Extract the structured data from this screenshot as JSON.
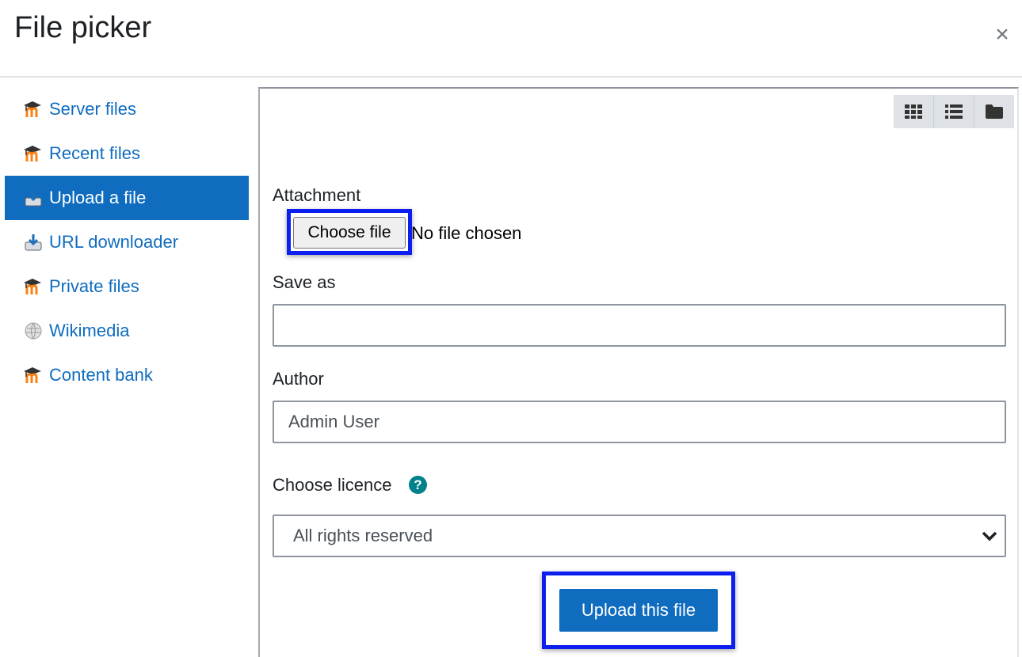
{
  "dialog": {
    "title": "File picker",
    "close_symbol": "×"
  },
  "sidebar": {
    "items": [
      {
        "label": "Server files",
        "icon": "moodle-icon",
        "active": false
      },
      {
        "label": "Recent files",
        "icon": "moodle-icon",
        "active": false
      },
      {
        "label": "Upload a file",
        "icon": "upload-repository-icon",
        "active": true
      },
      {
        "label": "URL downloader",
        "icon": "url-downloader-icon",
        "active": false
      },
      {
        "label": "Private files",
        "icon": "moodle-icon",
        "active": false
      },
      {
        "label": "Wikimedia",
        "icon": "wikimedia-globe-icon",
        "active": false
      },
      {
        "label": "Content bank",
        "icon": "moodle-icon",
        "active": false
      }
    ]
  },
  "toolbar": {
    "views": [
      "grid-view-icon",
      "list-view-icon",
      "tree-view-icon"
    ]
  },
  "form": {
    "attachment_label": "Attachment",
    "choose_file_label": "Choose file",
    "no_file_text": "No file chosen",
    "save_as_label": "Save as",
    "save_as_value": "",
    "author_label": "Author",
    "author_value": "Admin User",
    "licence_label": "Choose licence",
    "help_symbol": "?",
    "licence_value": "All rights reserved",
    "upload_button": "Upload this file"
  },
  "colors": {
    "accent": "#0f6cbf",
    "highlight": "#0b1ff0",
    "help": "#00828c"
  }
}
